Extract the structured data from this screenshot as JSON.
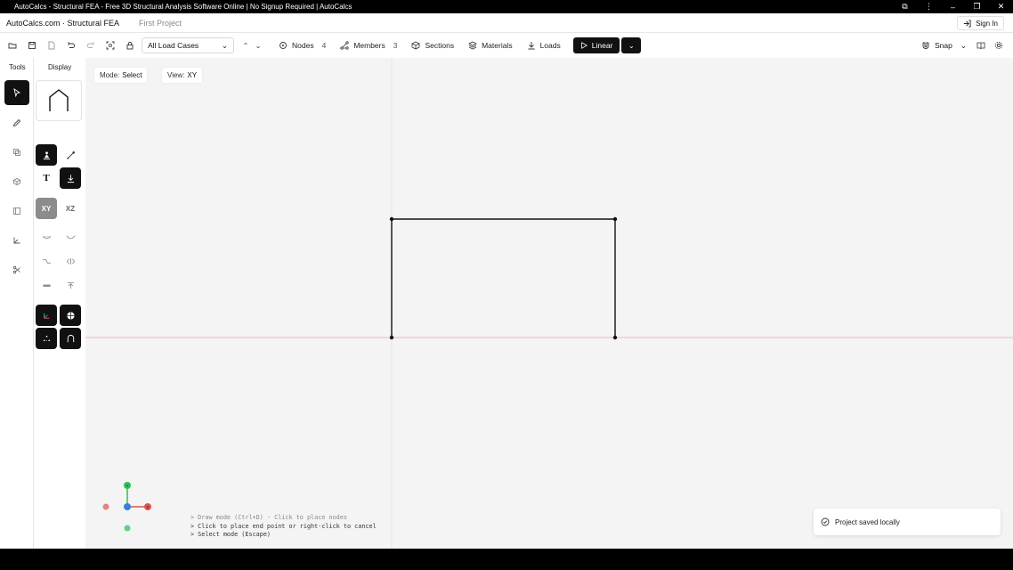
{
  "window": {
    "title": "AutoCalcs - Structural FEA - Free 3D Structural Analysis Software Online | No Signup Required | AutoCalcs",
    "controls": [
      "extension-icon",
      "more-icon",
      "minimize-icon",
      "restore-icon",
      "close-icon"
    ]
  },
  "header": {
    "brand": "AutoCalcs.com · Structural FEA",
    "project": "First Project",
    "sign_in": "Sign In"
  },
  "toolbar": {
    "load_case": "All Load Cases",
    "nodes_label": "Nodes",
    "nodes_count": "4",
    "members_label": "Members",
    "members_count": "3",
    "sections_label": "Sections",
    "materials_label": "Materials",
    "loads_label": "Loads",
    "run_label": "Linear",
    "snap_label": "Snap"
  },
  "panels": {
    "tools_tab": "Tools",
    "display_tab": "Display",
    "plane_xy": "XY",
    "plane_xz": "XZ",
    "text_tool": "T"
  },
  "canvas": {
    "mode_key": "Mode:",
    "mode_value": "Select",
    "view_key": "View:",
    "view_value": "XY"
  },
  "axes": {
    "y": "Y",
    "x": "X"
  },
  "console": [
    "> Draw mode (Ctrl+D) - Click to place nodes",
    "> Click to place end point or right-click to cancel",
    "> Select mode (Escape)"
  ],
  "toast": {
    "message": "Project saved locally"
  },
  "colors": {
    "accent": "#111111",
    "axis_x": "#e05252",
    "axis_y": "#2fbf5a",
    "axis_z": "#3b7ddd",
    "ground_line": "#f0b8b8",
    "canvas_bg": "#f4f4f4"
  }
}
